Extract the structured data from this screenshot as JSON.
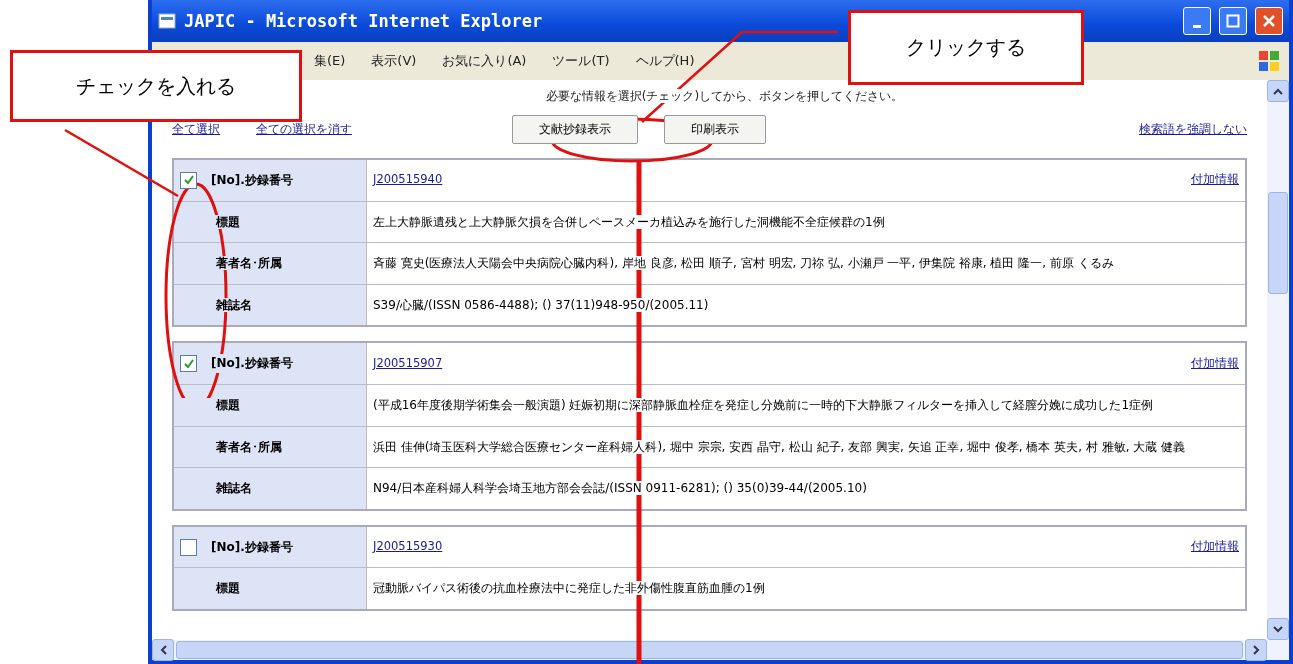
{
  "window": {
    "title": "JAPIC - Microsoft Internet Explorer"
  },
  "menu": [
    "集(E)",
    "表示(V)",
    "お気に入り(A)",
    "ツール(T)",
    "ヘルプ(H)"
  ],
  "page": {
    "instruction": "必要な情報を選択(チェック)してから、ボタンを押してください。",
    "select_links": [
      "全て選択",
      "全ての選択を消す"
    ],
    "buttons": [
      "文献抄録表示",
      "印刷表示"
    ],
    "highlight_link": "検索語を強調しない"
  },
  "records": [
    {
      "checked": true,
      "number_label": "[No].抄録番号",
      "number": "J200515940",
      "extra_link": "付加情報",
      "rows": [
        {
          "label": "標題",
          "value": "左上大静脈遺残と上大静脈欠損を合併しペースメーカ植込みを施行した洞機能不全症候群の1例"
        },
        {
          "label": "著者名･所属",
          "value": "斉藤 寛史(医療法人天陽会中央病院心臓内科), 岸地 良彦, 松田 順子, 宮村 明宏, 刀祢 弘, 小瀬戸 一平, 伊集院 裕康, 植田 隆一, 前原 くるみ"
        },
        {
          "label": "雑誌名",
          "value": "S39/心臓/(ISSN 0586-4488); () 37(11)948-950/(2005.11)"
        }
      ]
    },
    {
      "checked": true,
      "number_label": "[No].抄録番号",
      "number": "J200515907",
      "extra_link": "付加情報",
      "rows": [
        {
          "label": "標題",
          "value": "(平成16年度後期学術集会一般演題) 妊娠初期に深部静脈血栓症を発症し分娩前に一時的下大静脈フィルターを挿入して経膣分娩に成功した1症例"
        },
        {
          "label": "著者名･所属",
          "value": "浜田 佳伸(埼玉医科大学総合医療センター産科婦人科), 堀中 宗宗, 安西 晶守, 松山 紀子, 友部 興実, 矢追 正幸, 堀中 俊孝, 橋本 英夫, 村 雅敏, 大蔵 健義"
        },
        {
          "label": "雑誌名",
          "value": "N94/日本産科婦人科学会埼玉地方部会会誌/(ISSN 0911-6281); () 35(0)39-44/(2005.10)"
        }
      ]
    },
    {
      "checked": false,
      "number_label": "[No].抄録番号",
      "number": "J200515930",
      "extra_link": "付加情報",
      "rows": [
        {
          "label": "標題",
          "value": "冠動脈バイパス術後の抗血栓療法中に発症した非外傷性腹直筋血腫の1例"
        }
      ]
    }
  ],
  "annotations": {
    "callouts": [
      "チェックを入れる",
      "クリックする"
    ]
  }
}
